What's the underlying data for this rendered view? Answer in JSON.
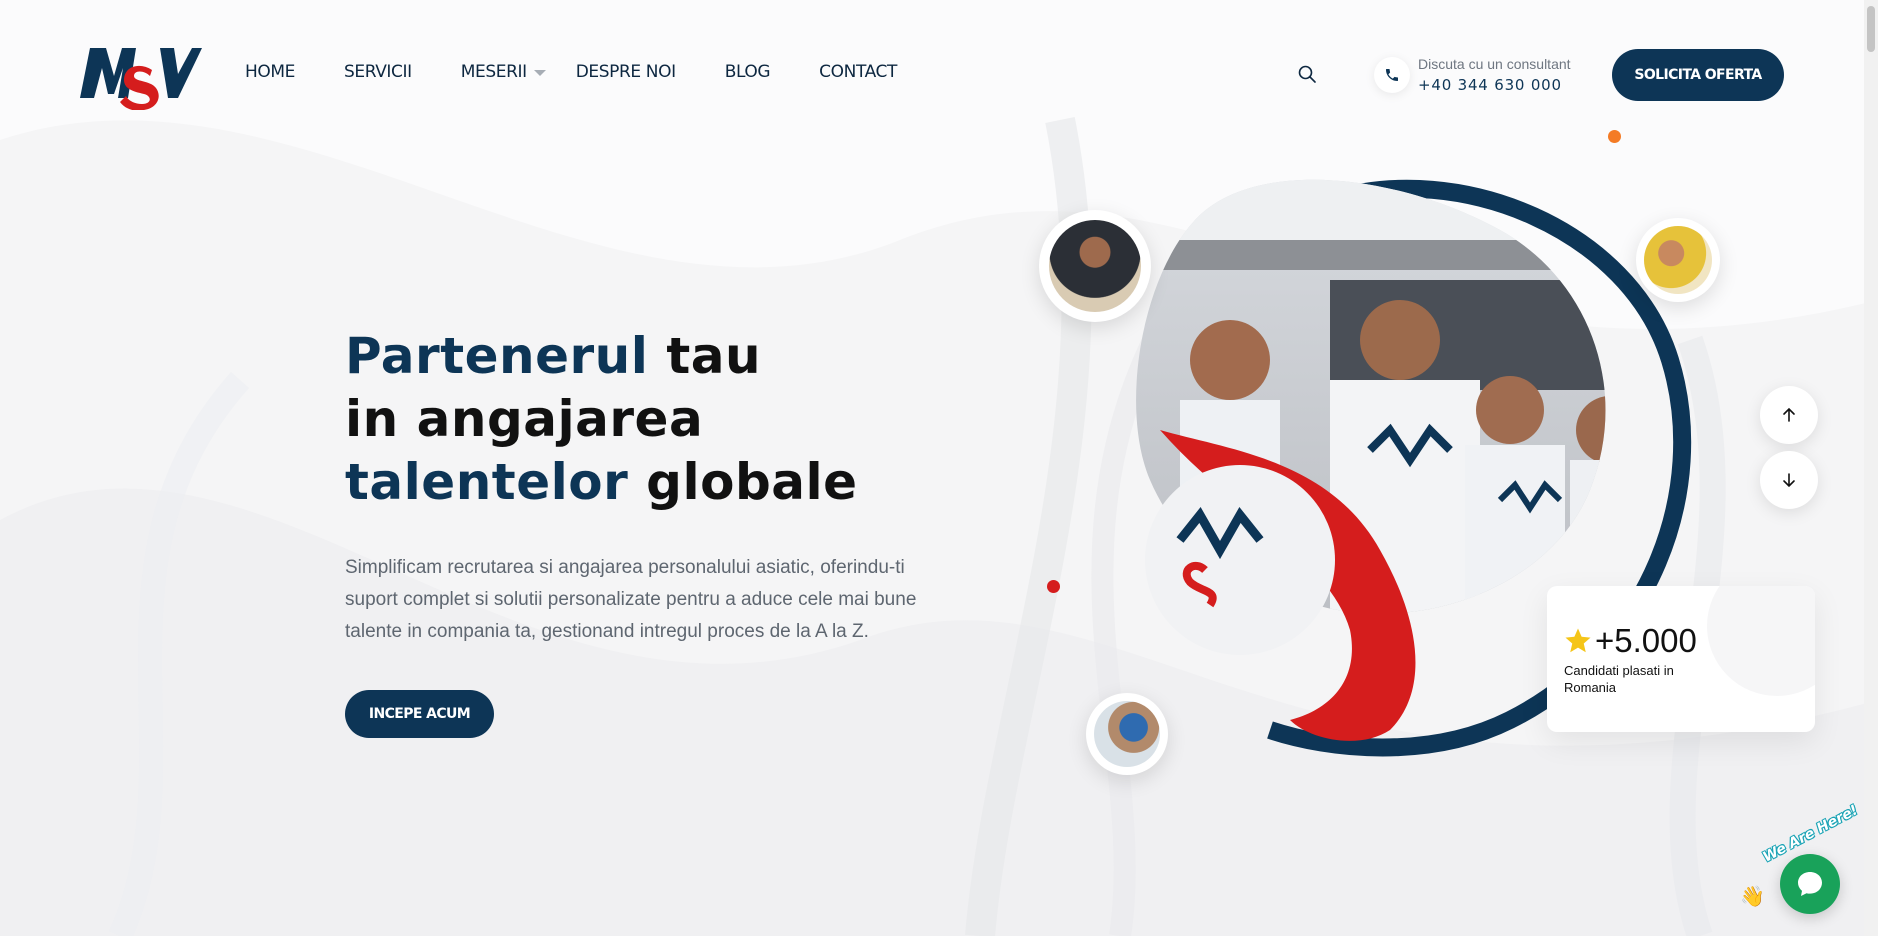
{
  "brand": {
    "logo_alt": "MSV"
  },
  "nav": {
    "items": [
      {
        "label": "HOME"
      },
      {
        "label": "SERVICII"
      },
      {
        "label": "MESERII",
        "has_dropdown": true
      },
      {
        "label": "DESPRE NOI"
      },
      {
        "label": "BLOG"
      },
      {
        "label": "CONTACT"
      }
    ]
  },
  "header": {
    "search_icon": "search-icon",
    "phone_label": "Discuta cu un consultant",
    "phone_number": "+40 344 630 000",
    "cta_label": "SOLICITA OFERTA"
  },
  "hero": {
    "title_line1_accent": "Partenerul",
    "title_line1_rest": " tau",
    "title_line2": "in angajarea",
    "title_line3_accent": "talentelor",
    "title_line3_rest": " globale",
    "subtitle": "Simplificam recrutarea si angajarea personalului asiatic, oferindu-ti suport complet si solutii personalizate pentru a aduce cele mai bune talente in compania ta, gestionand intregul proces de la A la Z.",
    "cta_label": "INCEPE ACUM"
  },
  "stats": {
    "value": "+5.000",
    "label": "Candidati plasati in Romania",
    "icon": "star-icon"
  },
  "chat": {
    "tag": "We Are Here!",
    "icon": "chat-bubble-icon"
  },
  "colors": {
    "primary": "#0d3556",
    "accent_red": "#d51d1d",
    "orange_dot": "#f47b25",
    "chat_green": "#19a25a"
  }
}
